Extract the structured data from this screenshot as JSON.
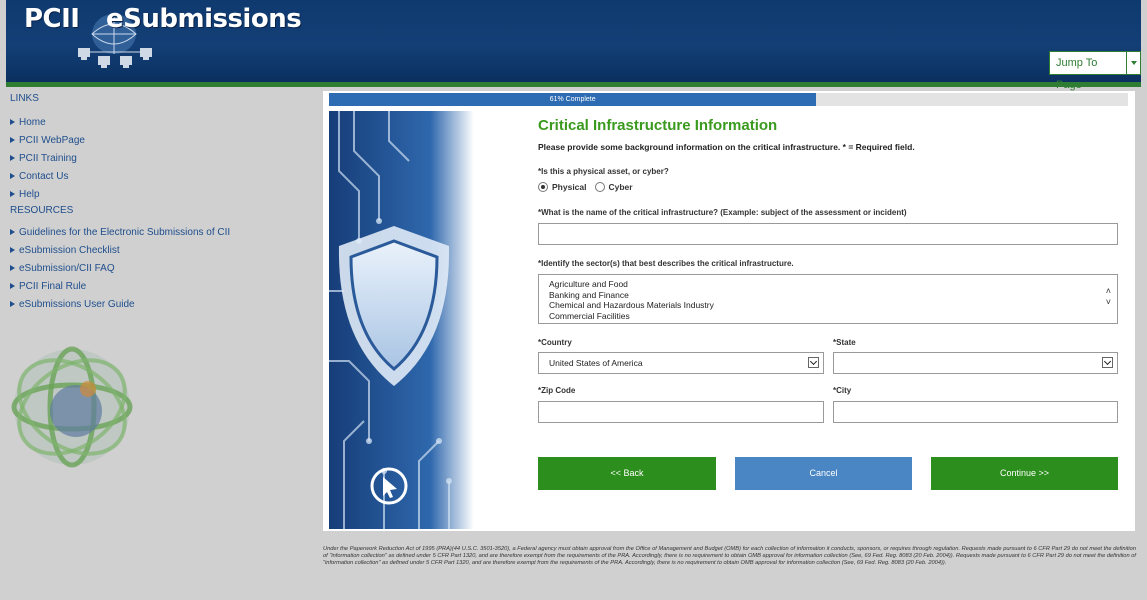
{
  "header": {
    "logo_left": "PCII",
    "logo_right": "eSubmissions",
    "jump_label": "Jump To Page"
  },
  "sidebar": {
    "links_heading": "LINKS",
    "links": [
      {
        "label": "Home"
      },
      {
        "label": "PCII WebPage"
      },
      {
        "label": "PCII Training"
      },
      {
        "label": "Contact Us"
      },
      {
        "label": "Help"
      }
    ],
    "resources_heading": "RESOURCES",
    "resources": [
      {
        "label": "Guidelines for the Electronic Submissions of CII"
      },
      {
        "label": "eSubmission Checklist"
      },
      {
        "label": "eSubmission/CII FAQ"
      },
      {
        "label": "PCII Final Rule"
      },
      {
        "label": "eSubmissions User Guide"
      }
    ]
  },
  "progress": {
    "label": "61% Complete",
    "percent": 61
  },
  "form": {
    "title": "Critical Infrastructure Information",
    "subtitle": "Please provide some background information on the critical infrastructure. * = Required field.",
    "q_asset": "*Is this a physical asset, or cyber?",
    "opt_physical": "Physical",
    "opt_cyber": "Cyber",
    "q_name": "*What is the name of the critical infrastructure? (Example: subject of the assessment or incident)",
    "name_value": "",
    "q_sector": "*Identify the sector(s) that best describes the critical infrastructure.",
    "sectors": [
      "Agriculture and Food",
      "Banking and Finance",
      "Chemical and Hazardous Materials Industry",
      "Commercial Facilities"
    ],
    "country_label": "*Country",
    "country_value": "United States of America",
    "state_label": "*State",
    "state_value": "",
    "zip_label": "*Zip Code",
    "zip_value": "",
    "city_label": "*City",
    "city_value": "",
    "back_label": "<< Back",
    "cancel_label": "Cancel",
    "continue_label": "Continue >>"
  },
  "footer": {
    "text": "Under the Paperwork Reduction Act of 1995 (PRA)(44 U.S.C. 3501-3520), a Federal agency must obtain approval from the Office of Management and Budget (OMB) for each collection of information it conducts, sponsors, or requires through regulation. Requests made pursuant to 6 CFR Part 29 do not meet the definition of \"information collection\" as defined under 5 CFR Part 1320, and are therefore exempt from the requirements of the PRA. Accordingly, there is no requirement to obtain OMB approval for information collection (See, 69 Fed. Reg. 8083 (20 Feb. 2004)). Requests made pursuant to 6 CFR Part 29 do not meet the definition of \"information collection\" as defined under 5 CFR Part 1320, and are therefore exempt from the requirements of the PRA. Accordingly, there is no requirement to obtain OMB approval for information collection (See, 69 Fed. Reg. 8083 (20 Feb. 2004))."
  },
  "colors": {
    "header_blue": "#0e3a70",
    "accent_green": "#2c8e1d",
    "title_green": "#3a9a1e",
    "progress_blue": "#2d6bb2",
    "cancel_blue": "#4a86c4"
  }
}
